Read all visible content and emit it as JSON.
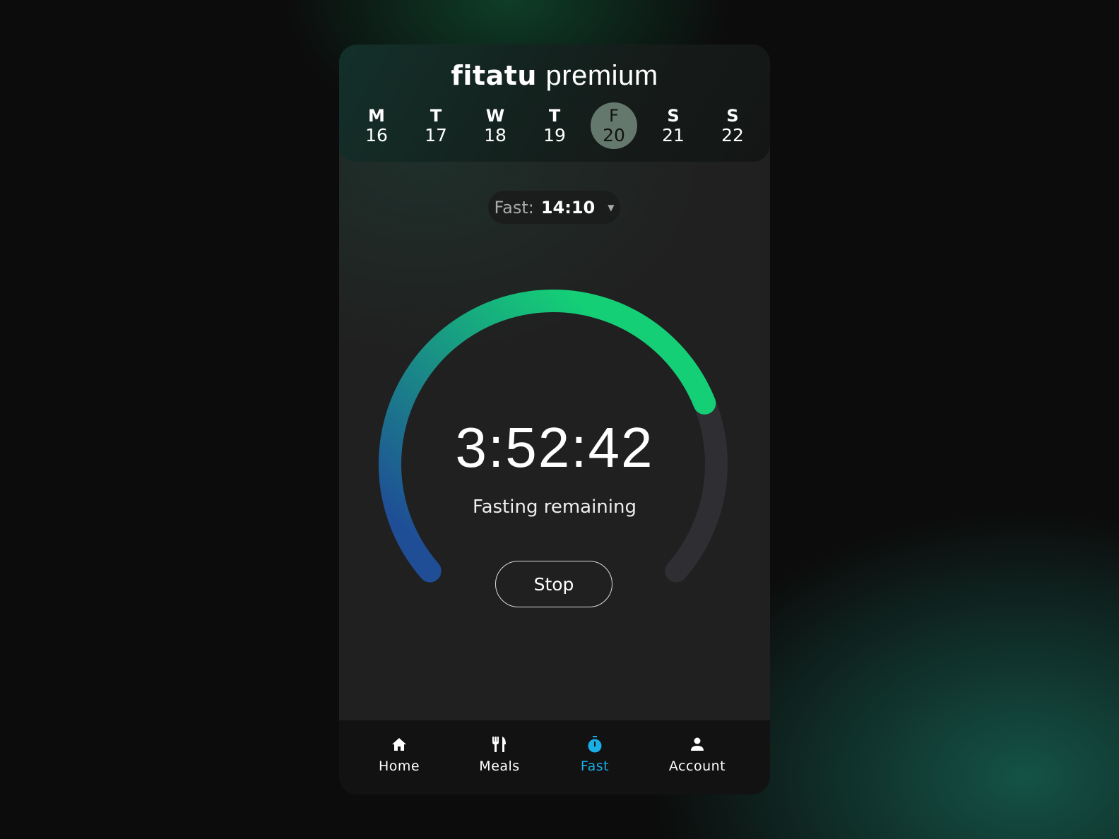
{
  "header": {
    "brand": "fitatu",
    "brand_suffix": "premium"
  },
  "week": [
    {
      "letter": "M",
      "date": "16"
    },
    {
      "letter": "T",
      "date": "17"
    },
    {
      "letter": "W",
      "date": "18"
    },
    {
      "letter": "T",
      "date": "19"
    },
    {
      "letter": "F",
      "date": "20",
      "selected": true
    },
    {
      "letter": "S",
      "date": "21"
    },
    {
      "letter": "S",
      "date": "22"
    }
  ],
  "fast_selector": {
    "label": "Fast:",
    "value": "14:10"
  },
  "timer": {
    "time": "3:52:42",
    "caption": "Fasting remaining",
    "progress": 0.76,
    "stop_label": "Stop"
  },
  "colors": {
    "gradient_start": "#1f4e96",
    "gradient_end": "#14cf76",
    "track": "#2f2f33",
    "active_tab": "#19aee6"
  },
  "nav": [
    {
      "label": "Home",
      "icon": "home-icon"
    },
    {
      "label": "Meals",
      "icon": "fork-knife-icon"
    },
    {
      "label": "Fast",
      "icon": "stopwatch-icon",
      "active": true
    },
    {
      "label": "Account",
      "icon": "person-icon"
    }
  ]
}
